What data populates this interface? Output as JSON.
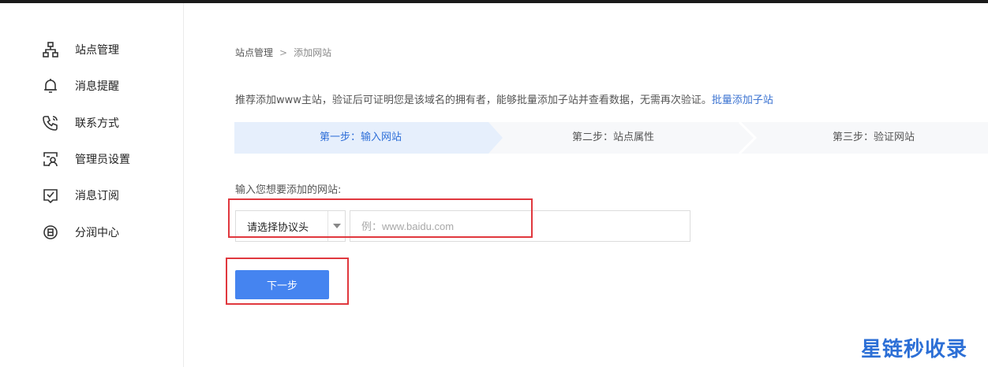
{
  "sidebar": {
    "items": [
      {
        "label": "站点管理",
        "icon": "sitemap-icon"
      },
      {
        "label": "消息提醒",
        "icon": "bell-icon"
      },
      {
        "label": "联系方式",
        "icon": "phone-icon"
      },
      {
        "label": "管理员设置",
        "icon": "admin-user-icon"
      },
      {
        "label": "消息订阅",
        "icon": "subscribe-check-icon"
      },
      {
        "label": "分润中心",
        "icon": "revenue-circle-icon"
      }
    ]
  },
  "breadcrumb": {
    "parent": "站点管理",
    "separator": ">",
    "current": "添加网站"
  },
  "tip": {
    "text": "推荐添加www主站，验证后可证明您是该域名的拥有者，能够批量添加子站并查看数据，无需再次验证。",
    "link": "批量添加子站"
  },
  "steps": [
    {
      "label": "第一步：输入网站",
      "active": true
    },
    {
      "label": "第二步：站点属性",
      "active": false
    },
    {
      "label": "第三步：验证网站",
      "active": false
    }
  ],
  "form": {
    "label": "输入您想要添加的网站:",
    "protocol_select": "请选择协议头",
    "url_placeholder": "例：www.baidu.com",
    "next_button": "下一步"
  },
  "watermark": "星链秒收录",
  "colors": {
    "accent": "#4584f0",
    "link": "#3b73d1",
    "highlight": "#e0383e",
    "step_active_bg": "#e6effc"
  }
}
